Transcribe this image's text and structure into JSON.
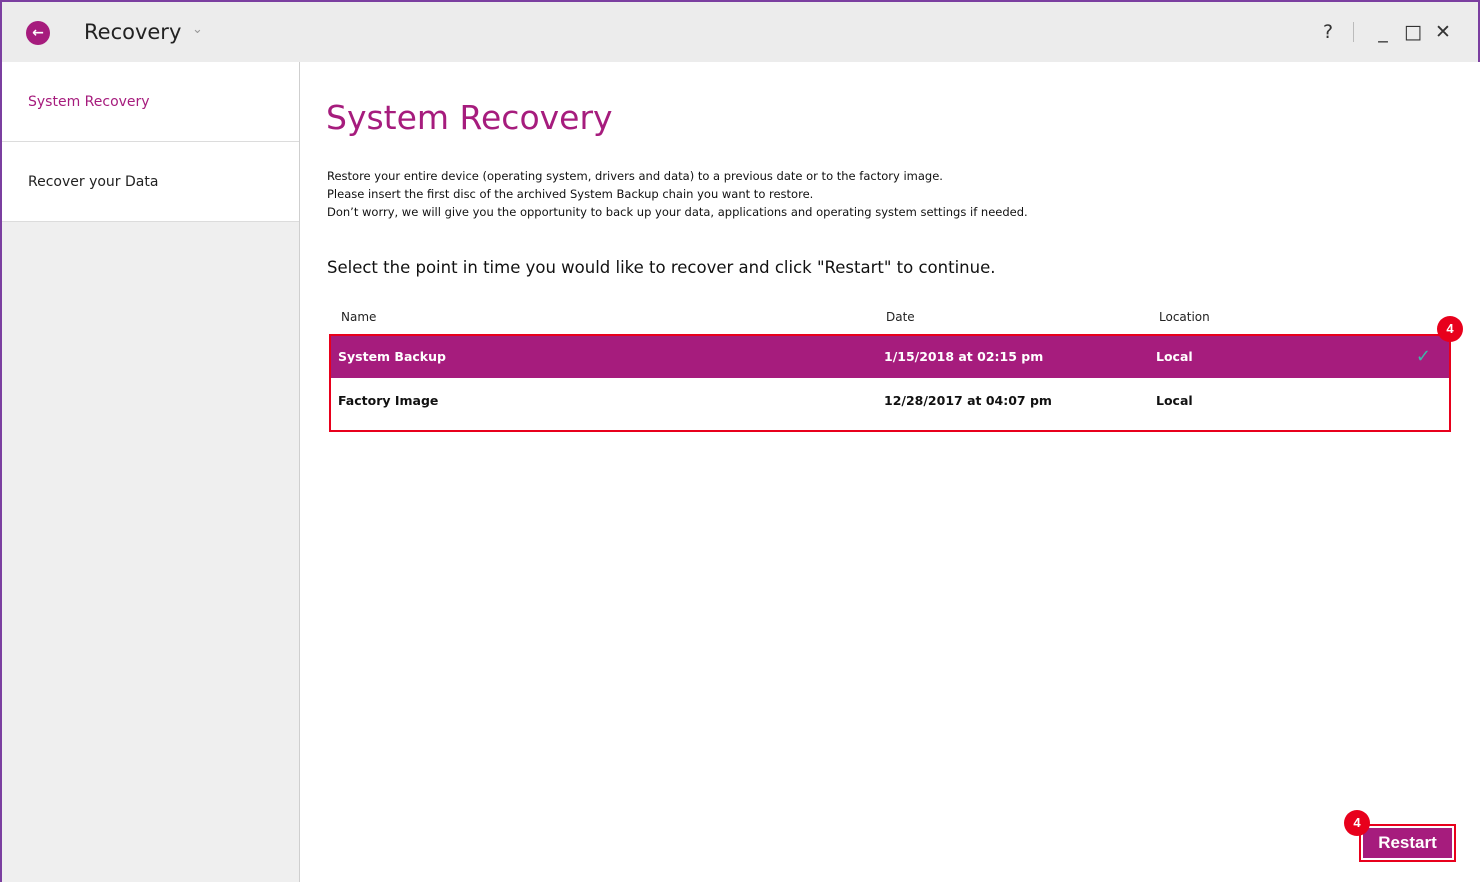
{
  "window": {
    "title": "Recovery",
    "controls": {
      "help": "?",
      "minimize": "_",
      "maximize": "□",
      "close": "✕"
    }
  },
  "sidebar": {
    "items": [
      {
        "label": "System Recovery",
        "active": true
      },
      {
        "label": "Recover your Data",
        "active": false
      }
    ]
  },
  "main": {
    "title": "System Recovery",
    "description": [
      "Restore your entire device (operating system, drivers and data) to a previous date or to the factory image.",
      "Please insert the first disc of the archived System Backup chain you want to restore.",
      "Don’t worry, we will give you the opportunity to back up your data, applications and operating system settings if needed."
    ],
    "instruction": "Select the point in time you would like to recover and click \"Restart\" to continue.",
    "table": {
      "headers": [
        "Name",
        "Date",
        "Location"
      ],
      "rows": [
        {
          "name": "System Backup",
          "date": "1/15/2018 at 02:15 pm",
          "location": "Local",
          "selected": true
        },
        {
          "name": "Factory Image",
          "date": "12/28/2017 at 04:07 pm",
          "location": "Local",
          "selected": false
        }
      ]
    },
    "restart_label": "Restart"
  },
  "annotations": {
    "step_badge": "4"
  },
  "colors": {
    "accent": "#a61c7d",
    "highlight": "#e8001c",
    "check": "#3fb5a8"
  }
}
